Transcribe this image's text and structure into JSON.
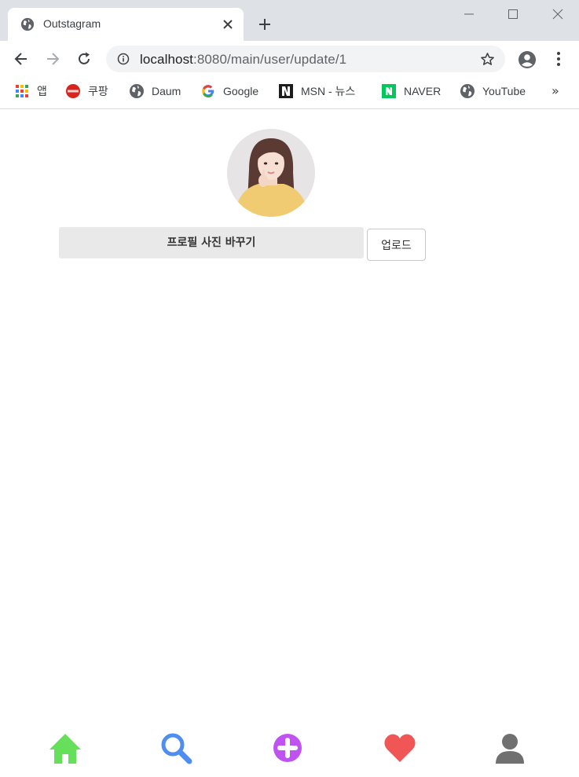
{
  "browser": {
    "tab": {
      "title": "Outstagram",
      "favicon": "globe-icon"
    },
    "address": {
      "host": "localhost",
      "path": ":8080/main/user/update/1"
    },
    "bookmarks": [
      {
        "label": "앱",
        "icon": "apps-grid-icon"
      },
      {
        "label": "쿠팡",
        "icon": "coupang-icon"
      },
      {
        "label": "Daum",
        "icon": "globe-icon"
      },
      {
        "label": "Google",
        "icon": "google-icon"
      },
      {
        "label": "MSN - 뉴스",
        "icon": "msn-icon"
      },
      {
        "label": "NAVER",
        "icon": "naver-icon"
      },
      {
        "label": "YouTube",
        "icon": "globe-icon"
      }
    ],
    "bookmarks_more": "»"
  },
  "profile": {
    "avatar": "profile-photo",
    "file_label": "프로필 사진 바꾸기",
    "upload_label": "업로드"
  },
  "bottom_nav": [
    {
      "name": "home",
      "icon": "home-icon",
      "color": "#66e05a"
    },
    {
      "name": "search",
      "icon": "search-icon",
      "color": "#4f8df0"
    },
    {
      "name": "add",
      "icon": "plus-circle-icon",
      "color": "#c152f2"
    },
    {
      "name": "likes",
      "icon": "heart-icon",
      "color": "#f15656"
    },
    {
      "name": "profile",
      "icon": "user-icon",
      "color": "#707070"
    }
  ]
}
